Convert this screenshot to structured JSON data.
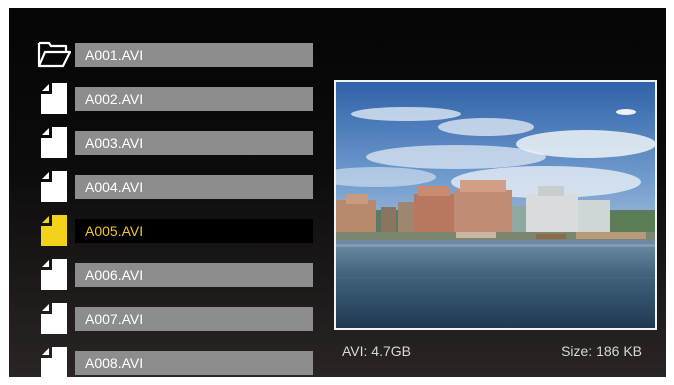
{
  "files": [
    {
      "name": "A001.AVI",
      "icon": "folder-icon",
      "selected": false
    },
    {
      "name": "A002.AVI",
      "icon": "file-icon",
      "selected": false
    },
    {
      "name": "A003.AVI",
      "icon": "file-icon",
      "selected": false
    },
    {
      "name": "A004.AVI",
      "icon": "file-icon",
      "selected": false
    },
    {
      "name": "A005.AVI",
      "icon": "file-icon",
      "selected": true
    },
    {
      "name": "A006.AVI",
      "icon": "file-icon",
      "selected": false
    },
    {
      "name": "A007.AVI",
      "icon": "file-icon",
      "selected": false
    },
    {
      "name": "A008.AVI",
      "icon": "file-icon",
      "selected": false
    }
  ],
  "preview": {
    "format_info": "AVI: 4.7GB",
    "size_info": "Size: 186 KB"
  },
  "colors": {
    "row_background": "#8d8d8d",
    "selected_row_background": "#000000",
    "selected_text": "#f1c628",
    "selected_icon": "#f2d21a",
    "icon": "#ffffff"
  }
}
